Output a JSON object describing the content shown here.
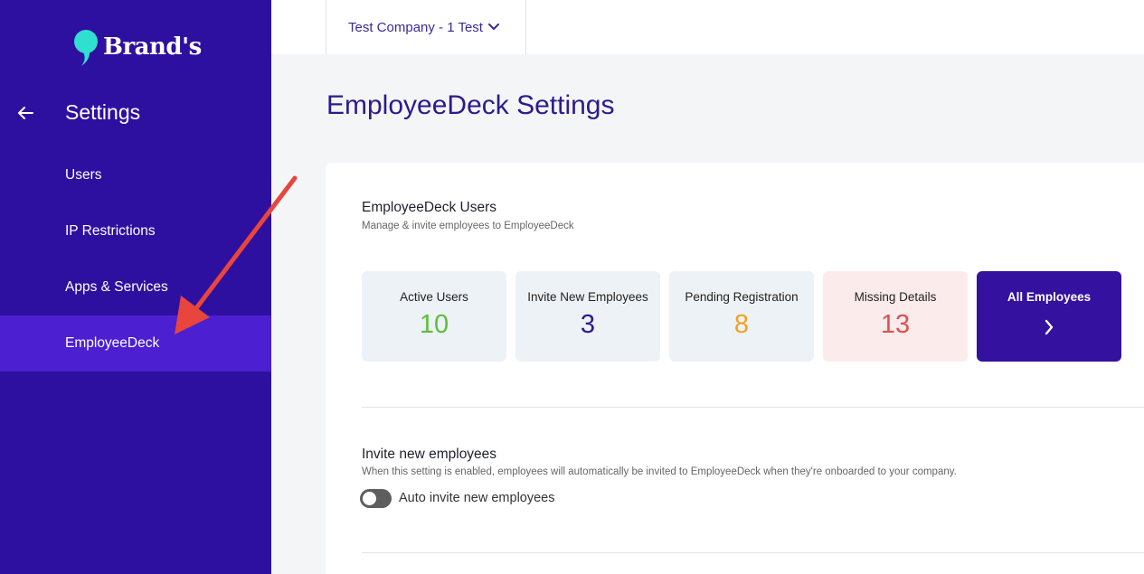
{
  "sidebar": {
    "logo_text": "Brand's",
    "settings_title": "Settings",
    "items": [
      {
        "label": "Users"
      },
      {
        "label": "IP Restrictions"
      },
      {
        "label": "Apps & Services"
      },
      {
        "label": "EmployeeDeck",
        "active": true
      }
    ]
  },
  "topbar": {
    "company": "Test Company - 1 Test"
  },
  "page": {
    "title": "EmployeeDeck Settings"
  },
  "users_section": {
    "title": "EmployeeDeck Users",
    "subtitle": "Manage & invite employees to EmployeeDeck",
    "stats": [
      {
        "label": "Active Users",
        "value": "10",
        "color": "#5cbf3a",
        "bg": "#edf2f6"
      },
      {
        "label": "Invite New Employees",
        "value": "3",
        "color": "#2e1a8c",
        "bg": "#edf2f6"
      },
      {
        "label": "Pending Registration",
        "value": "8",
        "color": "#f2a21e",
        "bg": "#edf2f6"
      },
      {
        "label": "Missing Details",
        "value": "13",
        "color": "#e0504f",
        "bg": "#fbeceb"
      }
    ],
    "all_employees_label": "All Employees"
  },
  "invite_section": {
    "title": "Invite new employees",
    "subtitle": "When this setting is enabled, employees will automatically be invited to EmployeeDeck when they're onboarded to your company.",
    "toggle_label": "Auto invite new employees",
    "toggle_on": false
  },
  "colors": {
    "sidebar": "#2e10a0",
    "sidebar_active": "#4c1fd1",
    "accent": "#34119e",
    "logo_mark": "#2fe0d0",
    "annotation_arrow": "#e8453c"
  },
  "icons": [
    "logo-icon",
    "back-arrow-icon",
    "chevron-down-icon",
    "chevron-right-icon",
    "annotation-arrow"
  ]
}
